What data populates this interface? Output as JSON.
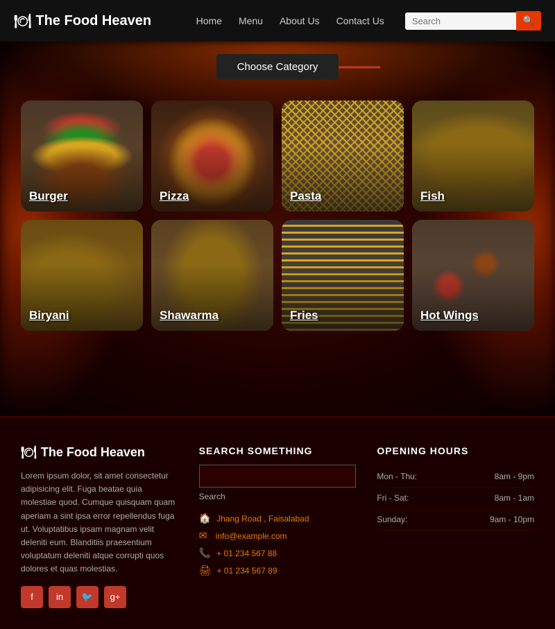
{
  "header": {
    "logo_text": "The Food Heaven",
    "logo_icon": "🍽",
    "nav": [
      {
        "label": "Home",
        "href": "#"
      },
      {
        "label": "Menu",
        "href": "#"
      },
      {
        "label": "About Us",
        "href": "#"
      },
      {
        "label": "Contact Us",
        "href": "#"
      }
    ],
    "search_placeholder": "Search"
  },
  "hero": {
    "category_button": "Choose Category"
  },
  "food_grid": [
    {
      "id": "burger",
      "label": "Burger",
      "css_class": "burger-img"
    },
    {
      "id": "pizza",
      "label": "Pizza",
      "css_class": "pizza-img"
    },
    {
      "id": "pasta",
      "label": "Pasta",
      "css_class": "pasta-img"
    },
    {
      "id": "fish",
      "label": "Fish",
      "css_class": "fish-img"
    },
    {
      "id": "biryani",
      "label": "Biryani",
      "css_class": "biryani-img"
    },
    {
      "id": "shawarma",
      "label": "Shawarma",
      "css_class": "shawarma-img"
    },
    {
      "id": "fries",
      "label": "Fries",
      "css_class": "fries-img"
    },
    {
      "id": "hotwings",
      "label": "Hot Wings",
      "css_class": "hotwings-img"
    }
  ],
  "footer": {
    "brand_logo": "The Food Heaven",
    "brand_icon": "🍽",
    "description": "Lorem ipsum dolor, sit amet consectetur adipisicing elit. Fuga beatae quia molestiae quod. Cumque quisquam quam aperiam a sint ipsa error repellendus fuga ut. Voluptatibus ipsam magnam velit deleniti eum.\n\nBlanditiis praesentium voluptatum deleniti atque corrupti quos dolores et quas molestias.",
    "social": [
      {
        "icon": "f",
        "name": "facebook"
      },
      {
        "icon": "in",
        "name": "instagram"
      },
      {
        "icon": "🐦",
        "name": "twitter"
      },
      {
        "icon": "g+",
        "name": "googleplus"
      }
    ],
    "search_section": {
      "title": "SEARCH SOMETHING",
      "placeholder": "",
      "label": "Search"
    },
    "contact": [
      {
        "icon": "🏠",
        "text": "Jhang Road , Faisalabad"
      },
      {
        "icon": "✉",
        "text": "info@example.com"
      },
      {
        "icon": "📞",
        "text": "+ 01 234 567 88"
      },
      {
        "icon": "🖨",
        "text": "+ 01 234 567 89"
      }
    ],
    "hours_section": {
      "title": "OPENING HOURS",
      "rows": [
        {
          "day": "Mon - Thu:",
          "time": "8am - 9pm"
        },
        {
          "day": "Fri - Sat:",
          "time": "8am - 1am"
        },
        {
          "day": "Sunday:",
          "time": "9am - 10pm"
        }
      ]
    }
  }
}
